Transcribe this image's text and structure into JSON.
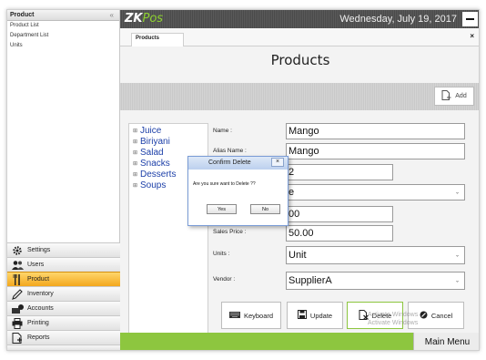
{
  "sidebar": {
    "header": "Product",
    "collapse_glyph": "«",
    "sub_items": [
      "Product List",
      "Department List",
      "Units"
    ],
    "nav": [
      {
        "label": "Settings",
        "icon": "gear-icon",
        "active": false
      },
      {
        "label": "Users",
        "icon": "users-icon",
        "active": false
      },
      {
        "label": "Product",
        "icon": "fork-knife-icon",
        "active": true
      },
      {
        "label": "Inventory",
        "icon": "pencil-icon",
        "active": false
      },
      {
        "label": "Accounts",
        "icon": "money-icon",
        "active": false
      },
      {
        "label": "Printing",
        "icon": "printer-icon",
        "active": false
      },
      {
        "label": "Reports",
        "icon": "report-icon",
        "active": false
      }
    ]
  },
  "topbar": {
    "logo_zk": "ZK",
    "logo_pos": "Pos",
    "datetime": "Wednesday, July 19, 2017"
  },
  "tab": {
    "label": "Products",
    "close": "×"
  },
  "page_title": "Products",
  "toolbar": {
    "add_label": "Add"
  },
  "categories": [
    "Juice",
    "Biriyani",
    "Salad",
    "Snacks",
    "Desserts",
    "Soups"
  ],
  "form": {
    "name_label": "Name :",
    "name_value": "Mango",
    "alias_label": "Alias Name :",
    "alias_value": "Mango",
    "code_value": "2",
    "group_value": "e",
    "price_value": "00",
    "sales_price_label": "Sales Price :",
    "sales_price_value": "50.00",
    "units_label": "Units :",
    "units_value": "Unit",
    "vendor_label": "Vendor :",
    "vendor_value": "SupplierA"
  },
  "actions": {
    "keyboard": "Keyboard",
    "update": "Update",
    "delete": "Delete",
    "cancel": "Cancel"
  },
  "watermark": {
    "line1": "Activate Windows",
    "line2": "Activate Windows"
  },
  "bottombar": {
    "main_menu": "Main Menu"
  },
  "modal": {
    "title": "Confirm Delete",
    "close": "×",
    "message": "Are you sure want to Delete ??",
    "yes": "Yes",
    "no": "No"
  },
  "colors": {
    "accent_green": "#8dc63f",
    "active_nav": "#f3a71d",
    "category_blue": "#1c3fa8"
  }
}
